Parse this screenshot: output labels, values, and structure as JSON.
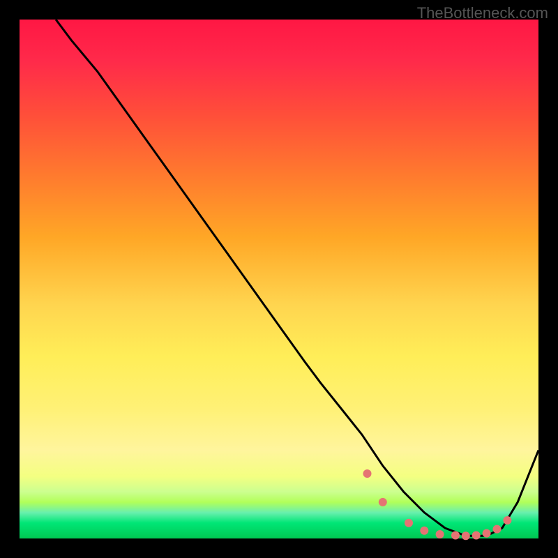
{
  "watermark": "TheBottleneck.com",
  "chart_data": {
    "type": "line",
    "title": "",
    "xlabel": "",
    "ylabel": "",
    "xlim": [
      0,
      100
    ],
    "ylim": [
      0,
      100
    ],
    "grid": false,
    "series": [
      {
        "name": "curve",
        "color": "#000000",
        "x": [
          7,
          10,
          15,
          20,
          25,
          30,
          35,
          40,
          45,
          50,
          55,
          58,
          62,
          66,
          70,
          74,
          78,
          82,
          86,
          90,
          93,
          96,
          100
        ],
        "y": [
          100,
          96,
          90,
          83,
          76,
          69,
          62,
          55,
          48,
          41,
          34,
          30,
          25,
          20,
          14,
          9,
          5,
          2,
          0.5,
          0.5,
          2,
          7,
          17
        ]
      }
    ],
    "dots": {
      "color": "#e57373",
      "radius": 6,
      "x": [
        67,
        70,
        75,
        78,
        81,
        84,
        86,
        88,
        90,
        92,
        94
      ],
      "y": [
        12.5,
        7,
        3,
        1.5,
        0.8,
        0.6,
        0.5,
        0.6,
        1,
        1.8,
        3.5
      ]
    }
  }
}
